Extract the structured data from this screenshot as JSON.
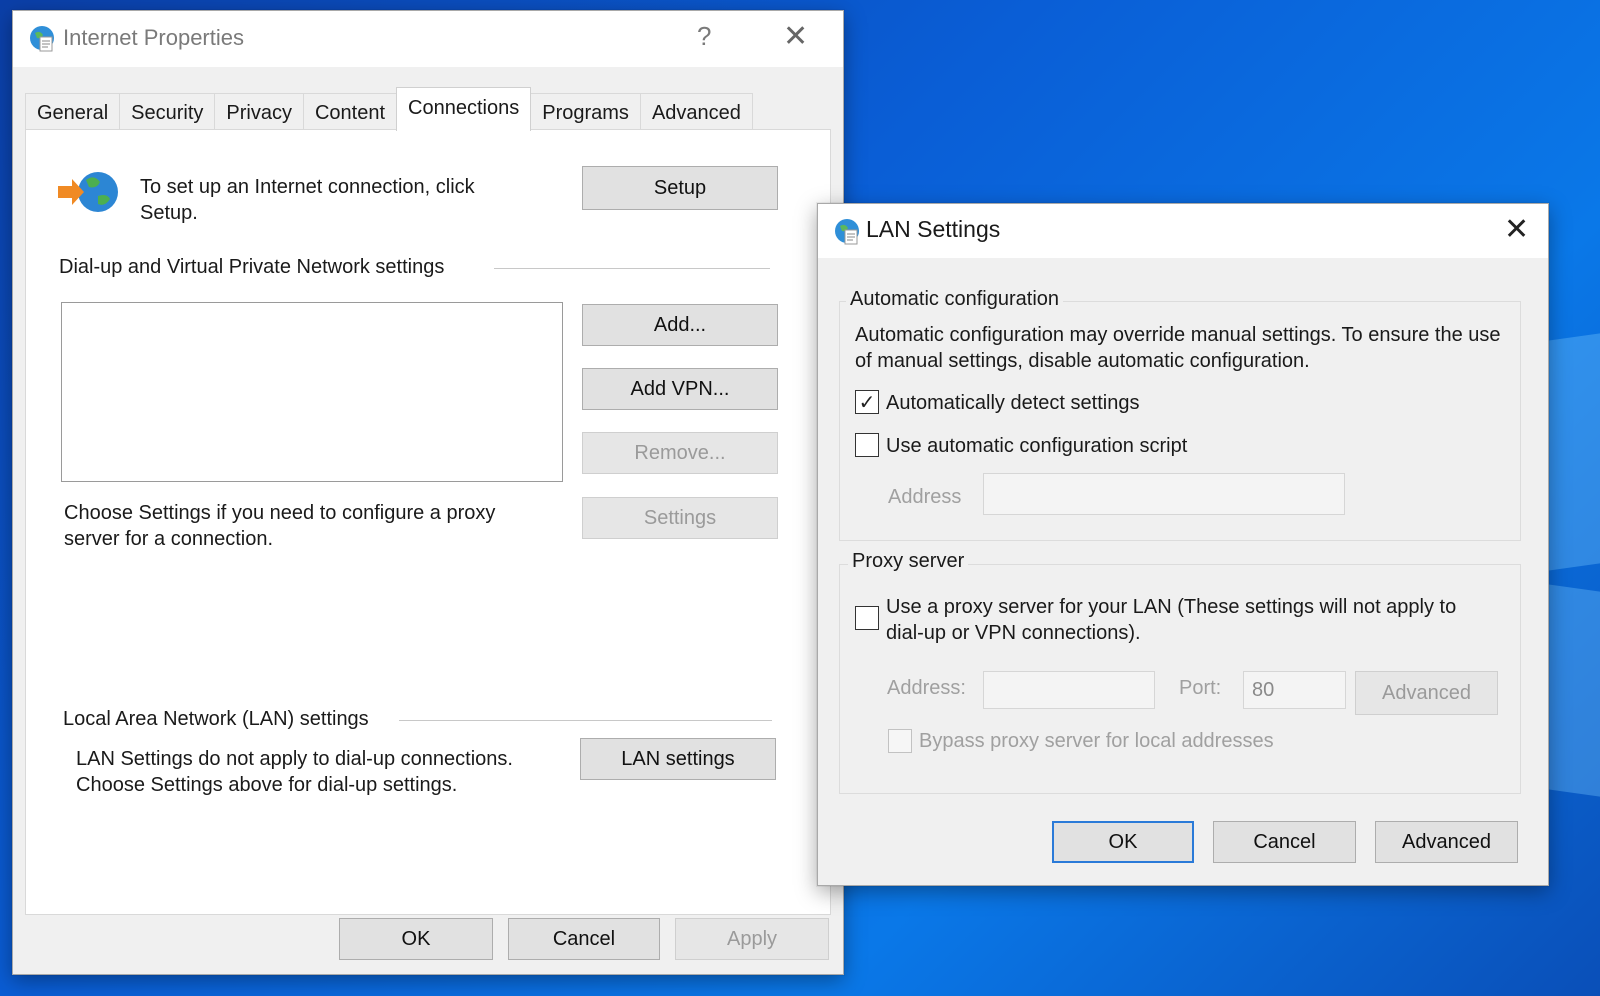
{
  "main_window": {
    "title": "Internet Properties",
    "help": "?",
    "close": "✕",
    "tabs": [
      "General",
      "Security",
      "Privacy",
      "Content",
      "Connections",
      "Programs",
      "Advanced"
    ],
    "active_tab": "Connections",
    "setup_text": "To set up an Internet connection, click Setup.",
    "setup_button": "Setup",
    "dialup_header": "Dial-up and Virtual Private Network settings",
    "add_button": "Add...",
    "add_vpn_button": "Add VPN...",
    "remove_button": "Remove...",
    "proxy_text": "Choose Settings if you need to configure a proxy server for a connection.",
    "settings_button": "Settings",
    "lan_header": "Local Area Network (LAN) settings",
    "lan_text": "LAN Settings do not apply to dial-up connections. Choose Settings above for dial-up settings.",
    "lan_settings_button": "LAN settings",
    "ok_button": "OK",
    "cancel_button": "Cancel",
    "apply_button": "Apply"
  },
  "lan_dialog": {
    "title": "LAN Settings",
    "close": "✕",
    "auto_group_label": "Automatic configuration",
    "auto_description": "Automatic configuration may override manual settings.  To ensure the use of manual settings, disable automatic configuration.",
    "auto_detect_label": "Automatically detect settings",
    "auto_detect_checked": true,
    "auto_script_label": "Use automatic configuration script",
    "auto_script_checked": false,
    "address_label": "Address",
    "address_value": "",
    "proxy_group_label": "Proxy server",
    "use_proxy_label": "Use a proxy server for your LAN (These settings will not apply to dial-up or VPN connections).",
    "use_proxy_checked": false,
    "proxy_address_label": "Address:",
    "proxy_address_value": "",
    "port_label": "Port:",
    "port_value": "80",
    "proxy_advanced_button": "Advanced",
    "bypass_label": "Bypass proxy server for local addresses",
    "bypass_checked": false,
    "ok_button": "OK",
    "cancel_button": "Cancel",
    "advanced_button": "Advanced"
  },
  "check_glyph": "✓"
}
